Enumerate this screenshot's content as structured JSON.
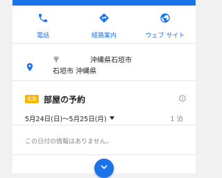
{
  "actions": {
    "call_label": "電話",
    "directions_label": "経路案内",
    "website_label": "ウェブ サイト"
  },
  "address": {
    "line1_postal_mark": "〒",
    "line1_city": "沖縄県石垣市",
    "line2": "石垣市 沖縄県"
  },
  "booking": {
    "ad_label": "広告",
    "title": "部屋の予約",
    "date_range": "5月24日(日)〜5月25日(月)",
    "nights": "1 泊",
    "no_info_message": "この日付の情報はありません。"
  },
  "colors": {
    "accent": "#1a73e8",
    "ad_badge": "#f6b400"
  },
  "icons": [
    "phone-icon",
    "directions-icon",
    "globe-icon",
    "location-pin-icon",
    "info-icon",
    "chevron-down-icon"
  ]
}
